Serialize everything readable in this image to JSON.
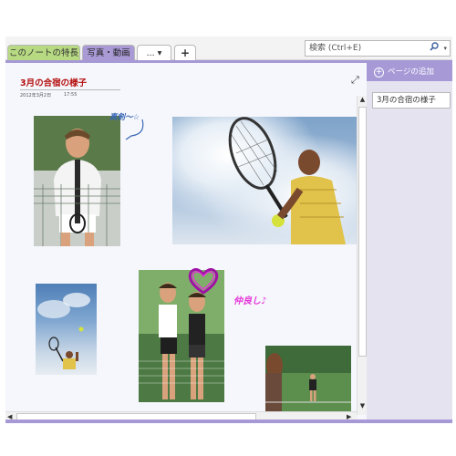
{
  "tabs": [
    {
      "label": "このノートの特長"
    },
    {
      "label": "写真・動画"
    },
    {
      "label": "... ▾"
    },
    {
      "label": "+"
    }
  ],
  "search": {
    "placeholder": "検索 (Ctrl+E)"
  },
  "page": {
    "title": "3月の合宿の様子",
    "date": "2012年3月2日",
    "time": "17:55"
  },
  "annotations": {
    "serious": "真剣～☆",
    "friends": "仲良し♪"
  },
  "side_panel": {
    "add_page_label": "ページの追加",
    "pages": [
      "3月の合宿の様子"
    ]
  },
  "colors": {
    "accent": "#a699d6",
    "tab_green": "#b7d982",
    "title_red": "#b40f0f",
    "annotation_blue": "#3a67b5",
    "annotation_pink": "#e635d9"
  },
  "icons": [
    "search-icon",
    "expand-icon",
    "add-page-icon",
    "scroll-up-icon",
    "scroll-down-icon",
    "scroll-left-icon",
    "scroll-right-icon"
  ]
}
